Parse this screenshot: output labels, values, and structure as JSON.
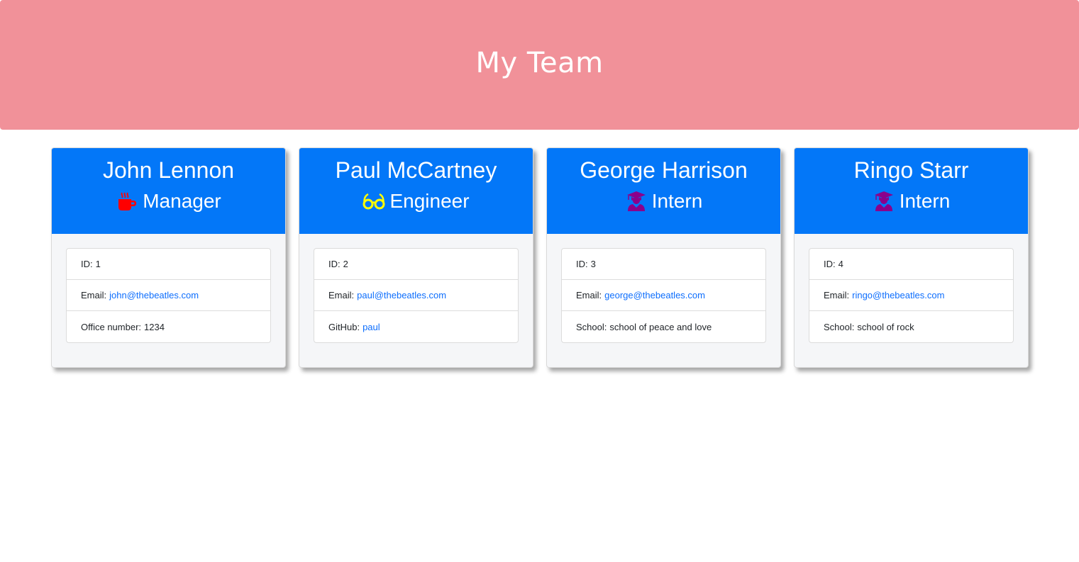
{
  "header": {
    "title": "My Team"
  },
  "colors": {
    "header_bg": "#f19199",
    "card_header_bg": "#0377f8",
    "manager_icon": "#ff0000",
    "engineer_icon": "#ffff00",
    "intern_icon": "#8b008b",
    "link": "#0d6efd"
  },
  "employees": [
    {
      "name": "John Lennon",
      "role": "Manager",
      "icon": "coffee-mug-icon",
      "id_label": "ID:",
      "id": "1",
      "email_label": "Email:",
      "email": "john@thebeatles.com",
      "extra_label": "Office number:",
      "extra": "1234"
    },
    {
      "name": "Paul McCartney",
      "role": "Engineer",
      "icon": "glasses-icon",
      "id_label": "ID:",
      "id": "2",
      "email_label": "Email:",
      "email": "paul@thebeatles.com",
      "extra_label": "GitHub:",
      "extra": "paul"
    },
    {
      "name": "George Harrison",
      "role": "Intern",
      "icon": "graduate-icon",
      "id_label": "ID:",
      "id": "3",
      "email_label": "Email:",
      "email": "george@thebeatles.com",
      "extra_label": "School:",
      "extra": "school of peace and love"
    },
    {
      "name": "Ringo Starr",
      "role": "Intern",
      "icon": "graduate-icon",
      "id_label": "ID:",
      "id": "4",
      "email_label": "Email:",
      "email": "ringo@thebeatles.com",
      "extra_label": "School:",
      "extra": "school of rock"
    }
  ]
}
